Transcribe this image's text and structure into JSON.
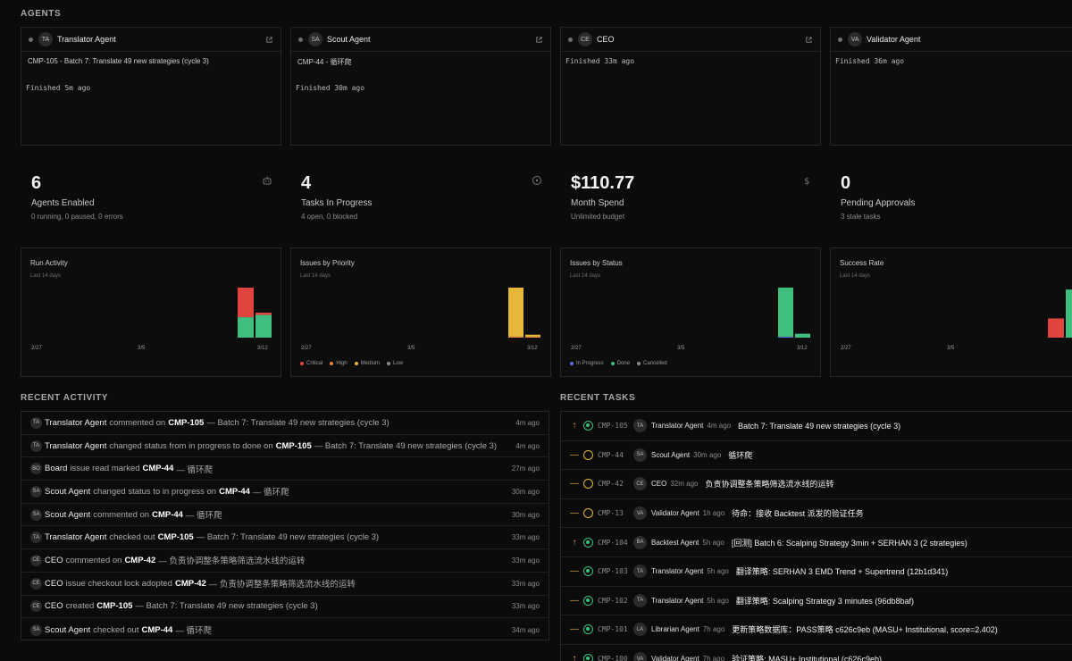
{
  "sections": {
    "agents": "AGENTS",
    "recent_activity": "RECENT ACTIVITY",
    "recent_tasks": "RECENT TASKS"
  },
  "agents": [
    {
      "initials": "TA",
      "name": "Translator Agent",
      "task": "CMP-105 - Batch 7: Translate 49 new strategies (cycle 3)",
      "status": "Finished 5m ago"
    },
    {
      "initials": "SA",
      "name": "Scout Agent",
      "task": "CMP-44 - 循环爬",
      "status": "Finished 30m ago"
    },
    {
      "initials": "CE",
      "name": "CEO",
      "task": "",
      "status": "Finished 33m ago"
    },
    {
      "initials": "VA",
      "name": "Validator Agent",
      "task": "",
      "status": "Finished 36m ago"
    }
  ],
  "kpis": [
    {
      "value": "6",
      "label": "Agents Enabled",
      "sub": "0 running, 0 paused, 0 errors",
      "icon": "robot-icon"
    },
    {
      "value": "4",
      "label": "Tasks In Progress",
      "sub": "4 open, 0 blocked",
      "icon": "circle-dot-icon"
    },
    {
      "value": "$110.77",
      "label": "Month Spend",
      "sub": "Unlimited budget",
      "icon": "dollar-icon"
    },
    {
      "value": "0",
      "label": "Pending Approvals",
      "sub": "3 stale tasks",
      "icon": "shield-icon"
    }
  ],
  "chart_data": [
    {
      "type": "bar",
      "title": "Run Activity",
      "subtitle": "Last 14 days",
      "x_ticks": [
        "2/27",
        "3/5",
        "3/12"
      ],
      "categories": [
        "3/11",
        "3/12"
      ],
      "series": [
        {
          "values": [
            9,
            10
          ],
          "color": "#3fbf7f"
        },
        {
          "values": [
            13,
            1
          ],
          "color": "#e0443f"
        }
      ],
      "ylim": [
        0,
        22
      ]
    },
    {
      "type": "bar",
      "title": "Issues by Priority",
      "subtitle": "Last 14 days",
      "x_ticks": [
        "2/27",
        "3/5",
        "3/12"
      ],
      "categories": [
        "3/11",
        "3/12"
      ],
      "series": [
        {
          "name": "Critical",
          "values": [
            0,
            0
          ],
          "color": "#e0443f"
        },
        {
          "name": "High",
          "values": [
            1,
            1
          ],
          "color": "#e8823a"
        },
        {
          "name": "Medium",
          "values": [
            50,
            2
          ],
          "color": "#e5b83a"
        },
        {
          "name": "Low",
          "values": [
            0,
            0
          ],
          "color": "#8a8a8a"
        }
      ],
      "ylim": [
        0,
        51
      ]
    },
    {
      "type": "bar",
      "title": "Issues by Status",
      "subtitle": "Last 14 days",
      "x_ticks": [
        "2/27",
        "3/5",
        "3/12"
      ],
      "categories": [
        "3/11",
        "3/12"
      ],
      "series": [
        {
          "name": "In Progress",
          "values": [
            1,
            0
          ],
          "color": "#5b6ee0"
        },
        {
          "name": "Done",
          "values": [
            50,
            4
          ],
          "color": "#3fbf7f"
        },
        {
          "name": "Cancelled",
          "values": [
            0,
            0
          ],
          "color": "#8a8a8a"
        }
      ],
      "ylim": [
        0,
        51
      ]
    },
    {
      "type": "bar",
      "title": "Success Rate",
      "subtitle": "Last 14 days",
      "x_ticks": [
        "2/27",
        "3/5"
      ],
      "categories": [
        "3/11",
        "3/12"
      ],
      "series": [
        {
          "values": [
            20,
            50
          ],
          "colors": [
            "#e0443f",
            "#3fbf7f"
          ]
        }
      ],
      "ylim": [
        0,
        52
      ]
    }
  ],
  "activity": [
    {
      "initials": "TA",
      "actor": "Translator Agent",
      "action": "commented on",
      "ref": "CMP-105",
      "detail": "— Batch 7: Translate 49 new strategies (cycle 3)",
      "time": "4m ago"
    },
    {
      "initials": "TA",
      "actor": "Translator Agent",
      "action": "changed status from in progress to done on",
      "ref": "CMP-105",
      "detail": "— Batch 7: Translate 49 new strategies (cycle 3)",
      "time": "4m ago"
    },
    {
      "initials": "BO",
      "actor": "Board",
      "action": "issue read marked",
      "ref": "CMP-44",
      "detail": "— 循环爬",
      "time": "27m ago"
    },
    {
      "initials": "SA",
      "actor": "Scout Agent",
      "action": "changed status to in progress on",
      "ref": "CMP-44",
      "detail": "— 循环爬",
      "time": "30m ago"
    },
    {
      "initials": "SA",
      "actor": "Scout Agent",
      "action": "commented on",
      "ref": "CMP-44",
      "detail": "— 循环爬",
      "time": "30m ago"
    },
    {
      "initials": "TA",
      "actor": "Translator Agent",
      "action": "checked out",
      "ref": "CMP-105",
      "detail": "— Batch 7: Translate 49 new strategies (cycle 3)",
      "time": "33m ago"
    },
    {
      "initials": "CE",
      "actor": "CEO",
      "action": "commented on",
      "ref": "CMP-42",
      "detail": "— 负责协调整条策略筛选流水线的运转",
      "time": "33m ago"
    },
    {
      "initials": "CE",
      "actor": "CEO",
      "action": "issue checkout lock adopted",
      "ref": "CMP-42",
      "detail": "— 负责协调整条策略筛选流水线的运转",
      "time": "33m ago"
    },
    {
      "initials": "CE",
      "actor": "CEO",
      "action": "created",
      "ref": "CMP-105",
      "detail": "— Batch 7: Translate 49 new strategies (cycle 3)",
      "time": "33m ago"
    },
    {
      "initials": "SA",
      "actor": "Scout Agent",
      "action": "checked out",
      "ref": "CMP-44",
      "detail": "— 循环爬",
      "time": "34m ago"
    }
  ],
  "tasks": [
    {
      "priority": "↑",
      "status": "done",
      "id": "CMP-105",
      "initials": "TA",
      "agent": "Translator Agent",
      "time": "4m ago",
      "title": "Batch 7: Translate 49 new strategies (cycle 3)"
    },
    {
      "priority": "—",
      "status": "todo",
      "id": "CMP-44",
      "initials": "SA",
      "agent": "Scout Agent",
      "time": "30m ago",
      "title": "循环爬"
    },
    {
      "priority": "—",
      "status": "todo",
      "id": "CMP-42",
      "initials": "CE",
      "agent": "CEO",
      "time": "32m ago",
      "title": "负责协调整条策略筛选流水线的运转"
    },
    {
      "priority": "—",
      "status": "todo",
      "id": "CMP-13",
      "initials": "VA",
      "agent": "Validator Agent",
      "time": "1h ago",
      "title": "待命：接收 Backtest 派发的验证任务"
    },
    {
      "priority": "↑",
      "status": "done",
      "id": "CMP-104",
      "initials": "BA",
      "agent": "Backtest Agent",
      "time": "5h ago",
      "title": "[回测] Batch 6: Scalping Strategy 3min + SERHAN 3 (2 strategies)"
    },
    {
      "priority": "—",
      "status": "done",
      "id": "CMP-103",
      "initials": "TA",
      "agent": "Translator Agent",
      "time": "5h ago",
      "title": "翻译策略: SERHAN 3 EMD Trend + Supertrend (12b1d341)"
    },
    {
      "priority": "—",
      "status": "done",
      "id": "CMP-102",
      "initials": "TA",
      "agent": "Translator Agent",
      "time": "5h ago",
      "title": "翻译策略: Scalping Strategy 3 minutes (96db8baf)"
    },
    {
      "priority": "—",
      "status": "done",
      "id": "CMP-101",
      "initials": "LA",
      "agent": "Librarian Agent",
      "time": "7h ago",
      "title": "更新策略数据库：PASS策略 c626c9eb (MASU+ Institutional, score=2.402)"
    },
    {
      "priority": "↑",
      "status": "done",
      "id": "CMP-100",
      "initials": "VA",
      "agent": "Validator Agent",
      "time": "7h ago",
      "title": "验证策略: MASU+ Institutional (c626c9eb)"
    }
  ]
}
